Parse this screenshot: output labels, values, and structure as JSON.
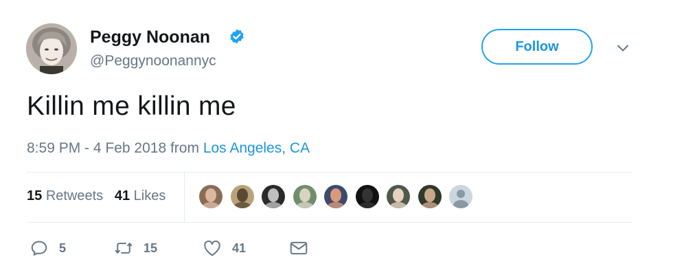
{
  "author": {
    "name": "Peggy Noonan",
    "handle": "@Peggynoonannyc",
    "verified": true,
    "avatar_icon": "profile-photo"
  },
  "header": {
    "follow_label": "Follow",
    "menu_icon": "chevron-down-icon"
  },
  "tweet": {
    "text": "Killin me killin me",
    "time": "8:59 PM - 4 Feb 2018",
    "from_label": "from",
    "location": "Los Angeles, CA"
  },
  "stats": {
    "retweets_count": "15",
    "retweets_label": "Retweets",
    "likes_count": "41",
    "likes_label": "Likes"
  },
  "likers": [
    {
      "name": "liker-avatar-1",
      "bg": "#8a6b55",
      "fg": "#d9b8a0"
    },
    {
      "name": "liker-avatar-2",
      "bg": "#b8a27a",
      "fg": "#5a4a35"
    },
    {
      "name": "liker-avatar-3",
      "bg": "#2a2a2a",
      "fg": "#bfbfbf"
    },
    {
      "name": "liker-avatar-4",
      "bg": "#6f8f6a",
      "fg": "#d8d3c2"
    },
    {
      "name": "liker-avatar-5",
      "bg": "#3d4a6b",
      "fg": "#d99a7a"
    },
    {
      "name": "liker-avatar-6",
      "bg": "#111111",
      "fg": "#333333"
    },
    {
      "name": "liker-avatar-7",
      "bg": "#4f5a4a",
      "fg": "#e6d2bf"
    },
    {
      "name": "liker-avatar-8",
      "bg": "#2f3a2c",
      "fg": "#c9a88a"
    },
    {
      "name": "liker-avatar-9",
      "bg": "#ccd6dd",
      "fg": "#8899a6"
    }
  ],
  "actions": {
    "reply_count": "5",
    "retweet_count": "15",
    "like_count": "41"
  },
  "colors": {
    "accent": "#1da1f2",
    "link": "#1b95e0",
    "muted": "#657786",
    "divider": "#e6ecf0"
  }
}
